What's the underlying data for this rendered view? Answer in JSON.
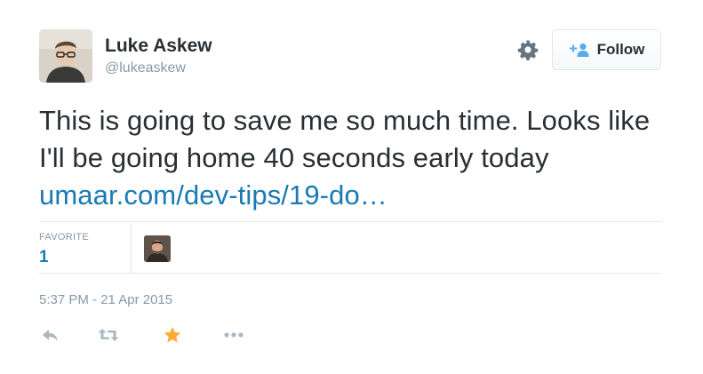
{
  "user": {
    "name": "Luke Askew",
    "handle": "@lukeaskew"
  },
  "header": {
    "follow_label": "Follow"
  },
  "tweet": {
    "text": "This is going to save me so much time. Looks like I'll be going home 40 seconds early today ",
    "link_text": "umaar.com/dev-tips/19-do…"
  },
  "stats": {
    "favorite_label": "FAVORITE",
    "favorite_count": "1"
  },
  "meta": {
    "timestamp": "5:37 PM - 21 Apr 2015"
  },
  "actions": [
    {
      "icon": "reply-icon"
    },
    {
      "icon": "retweet-icon"
    },
    {
      "icon": "favorite-star-icon",
      "color": "#ffac33",
      "active": true
    },
    {
      "icon": "more-options-icon"
    }
  ],
  "colors": {
    "link": "#1a7ab3",
    "muted": "#8899a6",
    "text": "#292f33",
    "favorite_active": "#ffac33",
    "follow_icon": "#55acee",
    "divider": "#e1e8ed"
  }
}
